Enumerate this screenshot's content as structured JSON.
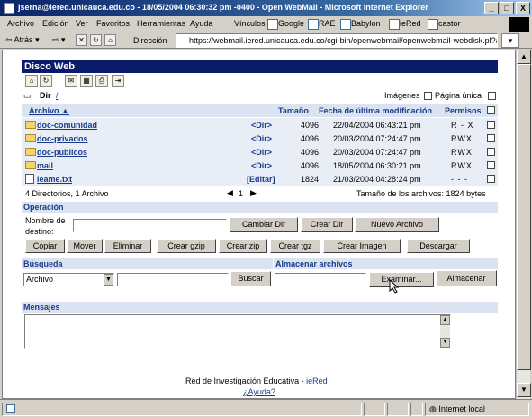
{
  "window": {
    "title": "jserna@iered.unicauca.edu.co - 18/05/2004 06:30:32 pm -0400 - Open WebMail - Microsoft Internet Explorer",
    "min": "_",
    "max": "□",
    "close": "X"
  },
  "menu": [
    "Archivo",
    "Edición",
    "Ver",
    "Favoritos",
    "Herramientas",
    "Ayuda"
  ],
  "links_label": "Vínculos",
  "links": [
    "Google",
    "RAE",
    "Babylon",
    "ieRed",
    "castor"
  ],
  "toolbar": {
    "back": "Atrás",
    "address_label": "Dirección",
    "url": "https://webmail.iered.unicauca.edu.co/cgi-bin/openwebmail/openwebmail-webdisk.pl?action=showdir&se"
  },
  "app": {
    "title": "Disco Web",
    "dir_label": "Dir",
    "dir_path": "/",
    "images_label": "Imágenes",
    "single_page_label": "Página única"
  },
  "table": {
    "headers": [
      "Archivo",
      "Tamaño",
      "Fecha de última modificación",
      "Permisos"
    ],
    "sort_arrow": "▲",
    "rows": [
      {
        "name": "doc-comunidad",
        "tag": "<Dir>",
        "size": "4096",
        "date": "22/04/2004 06:43:21 pm",
        "perm": "R - X"
      },
      {
        "name": "doc-privados",
        "tag": "<Dir>",
        "size": "4096",
        "date": "20/03/2004 07:24:47 pm",
        "perm": "RWX"
      },
      {
        "name": "doc-publicos",
        "tag": "<Dir>",
        "size": "4096",
        "date": "20/03/2004 07:24:47 pm",
        "perm": "RWX"
      },
      {
        "name": "mail",
        "tag": "<Dir>",
        "size": "4096",
        "date": "18/05/2004 06:30:21 pm",
        "perm": "RWX"
      },
      {
        "name": "leame.txt",
        "tag": "[Editar]",
        "size": "1824",
        "date": "21/03/2004 04:28:24 pm",
        "perm": "- - -"
      }
    ],
    "summary": "4 Directorios, 1 Archivo",
    "page": "1",
    "total": "Tamaño de los archivos: 1824 bytes"
  },
  "operacion": {
    "title": "Operación",
    "dest_label_1": "Nombre de",
    "dest_label_2": "destino:",
    "btn_cambiar": "Cambiar Dir",
    "btn_crear": "Crear Dir",
    "btn_nuevo": "Nuevo Archivo",
    "btn_copiar": "Copiar",
    "btn_mover": "Mover",
    "btn_eliminar": "Eliminar",
    "btn_gzip": "Crear gzip",
    "btn_zip": "Crear zip",
    "btn_tgz": "Crear tgz",
    "btn_imagen": "Crear Imagen",
    "btn_descargar": "Descargar"
  },
  "busqueda": {
    "title": "Búsqueda",
    "select": "Archivo",
    "btn": "Buscar"
  },
  "almacenar": {
    "title": "Almacenar archivos",
    "btn_examinar": "Examinar...",
    "btn_almacenar": "Almacenar"
  },
  "mensajes": {
    "title": "Mensajes"
  },
  "footer": {
    "text": "Red de Investigación Educativa - ",
    "link": "ieRed",
    "help": "¿Ayuda?"
  },
  "status": {
    "zone": "Internet local"
  }
}
